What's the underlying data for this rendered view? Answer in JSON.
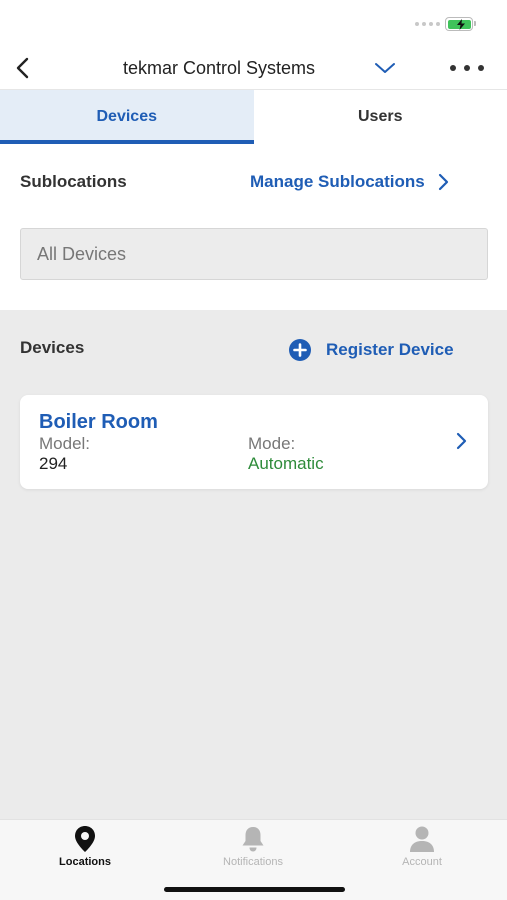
{
  "header": {
    "title": "tekmar Control Systems"
  },
  "tabs": [
    {
      "label": "Devices",
      "active": true
    },
    {
      "label": "Users",
      "active": false
    }
  ],
  "sublocations": {
    "label": "Sublocations",
    "manage_label": "Manage Sublocations",
    "filter_value": "All Devices"
  },
  "devices": {
    "label": "Devices",
    "register_label": "Register Device",
    "items": [
      {
        "name": "Boiler Room",
        "model_label": "Model:",
        "model_value": "294",
        "mode_label": "Mode:",
        "mode_value": "Automatic"
      }
    ]
  },
  "bottom_nav": [
    {
      "label": "Locations",
      "icon": "location-pin-icon",
      "active": true
    },
    {
      "label": "Notifications",
      "icon": "bell-icon",
      "active": false
    },
    {
      "label": "Account",
      "icon": "person-icon",
      "active": false
    }
  ],
  "colors": {
    "accent": "#1f5db5",
    "mode_green": "#2e8b3a",
    "tab_active_bg": "#e4edf7",
    "page_bg": "#ebebeb"
  }
}
